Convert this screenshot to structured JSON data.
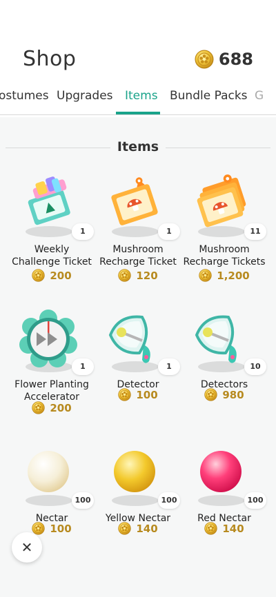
{
  "header": {
    "title": "Shop",
    "coins": "688"
  },
  "tabs": [
    {
      "label": "ostumes",
      "active": false
    },
    {
      "label": "Upgrades",
      "active": false
    },
    {
      "label": "Items",
      "active": true
    },
    {
      "label": "Bundle Packs",
      "active": false
    },
    {
      "label": "G",
      "active": false
    }
  ],
  "section": {
    "title": "Items"
  },
  "items": [
    {
      "name_line1": "Weekly",
      "name_line2": "Challenge Ticket",
      "count": "1",
      "price": "200",
      "icon": "weekly-challenge-ticket-icon"
    },
    {
      "name_line1": "Mushroom",
      "name_line2": "Recharge Ticket",
      "count": "1",
      "price": "120",
      "icon": "mushroom-recharge-ticket-icon"
    },
    {
      "name_line1": "Mushroom",
      "name_line2": "Recharge Tickets",
      "count": "11",
      "price": "1,200",
      "icon": "mushroom-recharge-tickets-icon"
    },
    {
      "name_line1": "Flower Planting",
      "name_line2": "Accelerator",
      "count": "1",
      "price": "200",
      "icon": "flower-accelerator-icon"
    },
    {
      "name_line1": "Detector",
      "name_line2": "",
      "count": "1",
      "price": "100",
      "icon": "detector-icon"
    },
    {
      "name_line1": "Detectors",
      "name_line2": "",
      "count": "10",
      "price": "980",
      "icon": "detectors-icon"
    },
    {
      "name_line1": "Nectar",
      "name_line2": "",
      "count": "100",
      "price": "100",
      "icon": "nectar-icon"
    },
    {
      "name_line1": "Yellow Nectar",
      "name_line2": "",
      "count": "100",
      "price": "140",
      "icon": "yellow-nectar-icon"
    },
    {
      "name_line1": "Red Nectar",
      "name_line2": "",
      "count": "100",
      "price": "140",
      "icon": "red-nectar-icon"
    }
  ],
  "colors": {
    "accent": "#1aa38a",
    "price": "#b78a1f",
    "coin": "#e6b62a"
  },
  "close": {
    "icon": "close-icon"
  }
}
